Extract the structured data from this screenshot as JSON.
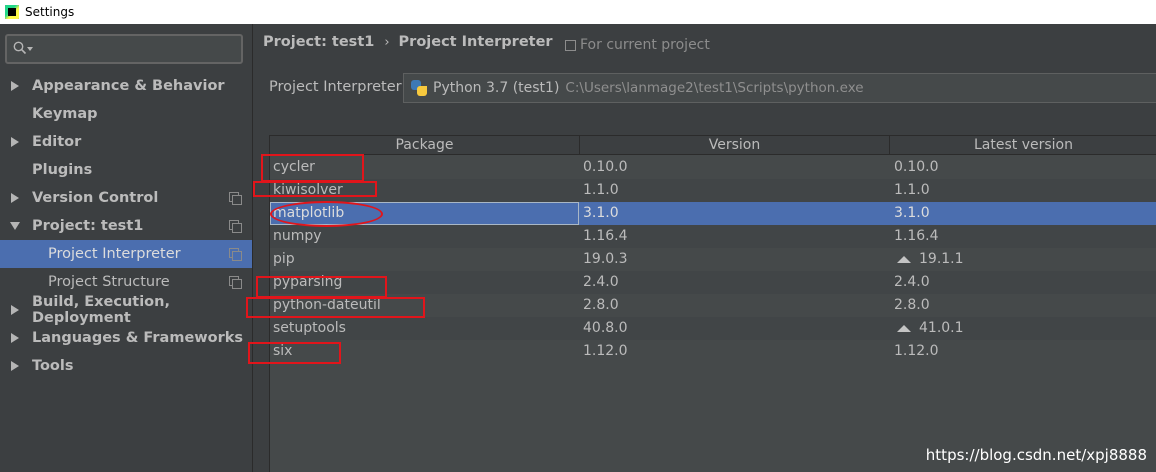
{
  "window": {
    "title": "Settings"
  },
  "sidebar": {
    "search": {
      "placeholder": ""
    },
    "items": [
      {
        "label": "Appearance & Behavior",
        "bold": true,
        "arrow": "right",
        "copy": false,
        "selected": false,
        "indent": 0
      },
      {
        "label": "Keymap",
        "bold": true,
        "arrow": "",
        "copy": false,
        "selected": false,
        "indent": 0
      },
      {
        "label": "Editor",
        "bold": true,
        "arrow": "right",
        "copy": false,
        "selected": false,
        "indent": 0
      },
      {
        "label": "Plugins",
        "bold": true,
        "arrow": "",
        "copy": false,
        "selected": false,
        "indent": 0
      },
      {
        "label": "Version Control",
        "bold": true,
        "arrow": "right",
        "copy": true,
        "selected": false,
        "indent": 0
      },
      {
        "label": "Project: test1",
        "bold": true,
        "arrow": "down",
        "copy": true,
        "selected": false,
        "indent": 0
      },
      {
        "label": "Project Interpreter",
        "bold": false,
        "arrow": "",
        "copy": true,
        "selected": true,
        "indent": 1
      },
      {
        "label": "Project Structure",
        "bold": false,
        "arrow": "",
        "copy": true,
        "selected": false,
        "indent": 1
      },
      {
        "label": "Build, Execution, Deployment",
        "bold": true,
        "arrow": "right",
        "copy": false,
        "selected": false,
        "indent": 0
      },
      {
        "label": "Languages & Frameworks",
        "bold": true,
        "arrow": "right",
        "copy": false,
        "selected": false,
        "indent": 0
      },
      {
        "label": "Tools",
        "bold": true,
        "arrow": "right",
        "copy": false,
        "selected": false,
        "indent": 0
      }
    ]
  },
  "main": {
    "breadcrumb": {
      "parent": "Project: test1",
      "separator": "›",
      "current": "Project Interpreter"
    },
    "scope_note": "For current project",
    "interpreter": {
      "label": "Project Interpreter:",
      "name": "Python 3.7 (test1)",
      "path": "C:\\Users\\lanmage2\\test1\\Scripts\\python.exe"
    },
    "table": {
      "columns": [
        "Package",
        "Version",
        "Latest version"
      ],
      "rows": [
        {
          "package": "cycler",
          "version": "0.10.0",
          "latest": "0.10.0",
          "upgrade": false,
          "selected": false
        },
        {
          "package": "kiwisolver",
          "version": "1.1.0",
          "latest": "1.1.0",
          "upgrade": false,
          "selected": false
        },
        {
          "package": "matplotlib",
          "version": "3.1.0",
          "latest": "3.1.0",
          "upgrade": false,
          "selected": true
        },
        {
          "package": "numpy",
          "version": "1.16.4",
          "latest": "1.16.4",
          "upgrade": false,
          "selected": false
        },
        {
          "package": "pip",
          "version": "19.0.3",
          "latest": "19.1.1",
          "upgrade": true,
          "selected": false
        },
        {
          "package": "pyparsing",
          "version": "2.4.0",
          "latest": "2.4.0",
          "upgrade": false,
          "selected": false
        },
        {
          "package": "python-dateutil",
          "version": "2.8.0",
          "latest": "2.8.0",
          "upgrade": false,
          "selected": false
        },
        {
          "package": "setuptools",
          "version": "40.8.0",
          "latest": "41.0.1",
          "upgrade": true,
          "selected": false
        },
        {
          "package": "six",
          "version": "1.12.0",
          "latest": "1.12.0",
          "upgrade": false,
          "selected": false
        }
      ]
    }
  },
  "colors": {
    "selection": "#4b6eaf",
    "annotation": "#e1151b",
    "background": "#3c3f41"
  },
  "watermark": "https://blog.csdn.net/xpj8888"
}
